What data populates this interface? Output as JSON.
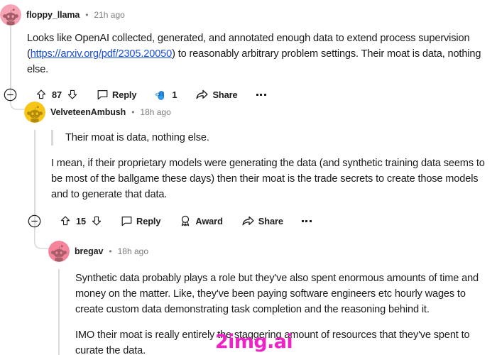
{
  "thread": {
    "comments": [
      {
        "id": "c1",
        "username": "floppy_llama",
        "separator": "•",
        "timestamp": "21h ago",
        "avatar_bg": "#f5a3b5",
        "avatar_fg": "#a65d68",
        "body": {
          "text_before_link": "Looks like OpenAI collected, generated, and annotated enough data to extend process supervision (",
          "link_text": "https://arxiv.org/pdf/2305.20050",
          "text_after_link": ") to reasonably arbitrary problem settings. Their moat is data, nothing else."
        },
        "actions": {
          "collapse_icon": "minus-circle-icon",
          "upvote_icon": "upvote-arrow-icon",
          "score": "87",
          "downvote_icon": "downvote-arrow-icon",
          "reply_icon": "speech-bubble-icon",
          "reply_label": "Reply",
          "award_icon": "high-five-hands-award-icon",
          "award_count": "1",
          "share_icon": "share-arrow-icon",
          "share_label": "Share",
          "overflow_icon": "kebab-menu-icon"
        }
      },
      {
        "id": "c2",
        "username": "VelveteenAmbush",
        "separator": "•",
        "timestamp": "18h ago",
        "avatar_bg": "#f5c518",
        "avatar_fg": "#b28b0d",
        "quote": "Their moat is data, nothing else.",
        "body_paragraph": "I mean, if their proprietary models were generating the data (and synthetic training data seems to be most of the ballgame these days) then their moat is the trade secrets to create those models and to generate that data.",
        "actions": {
          "collapse_icon": "minus-circle-icon",
          "upvote_icon": "upvote-arrow-icon",
          "score": "15",
          "downvote_icon": "downvote-arrow-icon",
          "reply_icon": "speech-bubble-icon",
          "reply_label": "Reply",
          "award_icon": "medal-award-icon",
          "award_label": "Award",
          "share_icon": "share-arrow-icon",
          "share_label": "Share",
          "overflow_icon": "kebab-menu-icon"
        }
      },
      {
        "id": "c3",
        "username": "bregav",
        "separator": "•",
        "timestamp": "18h ago",
        "avatar_bg": "#f5849b",
        "avatar_fg": "#a65d68",
        "paragraph_1": "Synthetic data probably plays a role but they've also spent enormous amounts of time and money on the matter. Like, they've been paying software engineers etc hourly wages to create custom data demonstrating task completion and the reasoning behind it.",
        "paragraph_2": "IMO their moat is really entirely the staggering amount of resources that they've spent to curate the data."
      }
    ]
  },
  "watermark": {
    "text": "2img.ai",
    "color": "#ef22c8"
  },
  "colors": {
    "link": "#1a4ed8",
    "thread_line": "#d9dadb",
    "text": "#1a1a1b",
    "muted": "#7c7c7c",
    "award_blue": "#2aa0f3"
  }
}
